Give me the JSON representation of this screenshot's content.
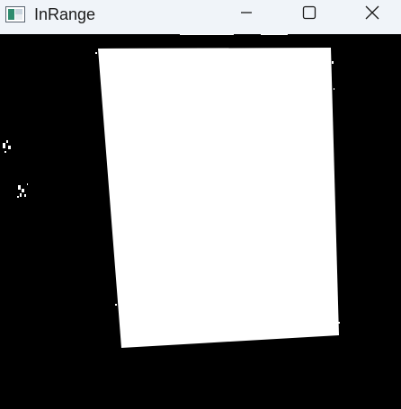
{
  "window": {
    "title": "InRange",
    "icon": "opencv-window-icon",
    "controls": [
      "minimize-icon",
      "maximize-icon",
      "close-icon"
    ]
  },
  "image": {
    "description_hidden": "",
    "foreground_color": "#ffffff",
    "background_color": "#000000"
  }
}
